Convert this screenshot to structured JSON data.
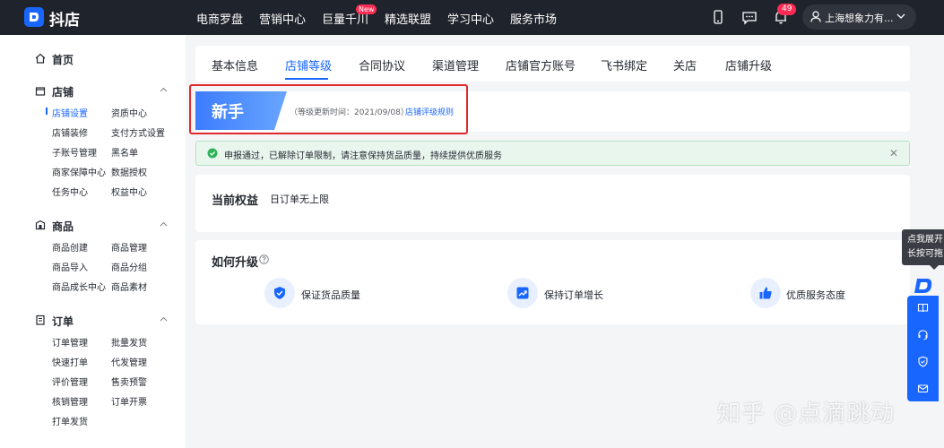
{
  "app": {
    "brand": "抖店"
  },
  "topnav": {
    "items": [
      "电商罗盘",
      "营销中心",
      "巨量千川",
      "精选联盟",
      "学习中心",
      "服务市场"
    ],
    "new_badge": "New",
    "notification_count": "49",
    "user_name": "上海想象力有..."
  },
  "sidebar": {
    "home": "首页",
    "sections": [
      {
        "title": "店铺",
        "links": [
          "店铺设置",
          "资质中心",
          "店铺装修",
          "支付方式设置",
          "子账号管理",
          "黑名单",
          "商家保障中心",
          "数据授权",
          "任务中心",
          "权益中心"
        ]
      },
      {
        "title": "商品",
        "links": [
          "商品创建",
          "商品管理",
          "商品导入",
          "商品分组",
          "商品成长中心",
          "商品素材"
        ]
      },
      {
        "title": "订单",
        "links": [
          "订单管理",
          "批量发货",
          "快速打单",
          "代发管理",
          "评价管理",
          "售卖预警",
          "核销管理",
          "订单开票",
          "打单发货"
        ]
      }
    ]
  },
  "tabs": [
    "基本信息",
    "店铺等级",
    "合同协议",
    "渠道管理",
    "店铺官方账号",
    "飞书绑定",
    "关店",
    "店铺升级"
  ],
  "level": {
    "name": "新手",
    "update_time": "（等级更新时间：2021/09/08）",
    "rule_link": "店铺评级规则"
  },
  "alert": {
    "text": "申报通过，已解除订单限制，请注意保持货品质量，持续提供优质服务"
  },
  "rights": {
    "title": "当前权益",
    "value": "日订单无上限"
  },
  "upgrade": {
    "title": "如何升级",
    "features": [
      "保证货品质量",
      "保持订单增长",
      "优质服务态度"
    ]
  },
  "floating": {
    "tooltip_line1": "点我展开",
    "tooltip_line2": "长按可拖"
  },
  "watermark": "知乎 @点滴跳动",
  "colors": {
    "accent": "#1966ff",
    "topbar": "#1f232b",
    "highlight": "#e2292e",
    "success": "#2fb35a"
  }
}
